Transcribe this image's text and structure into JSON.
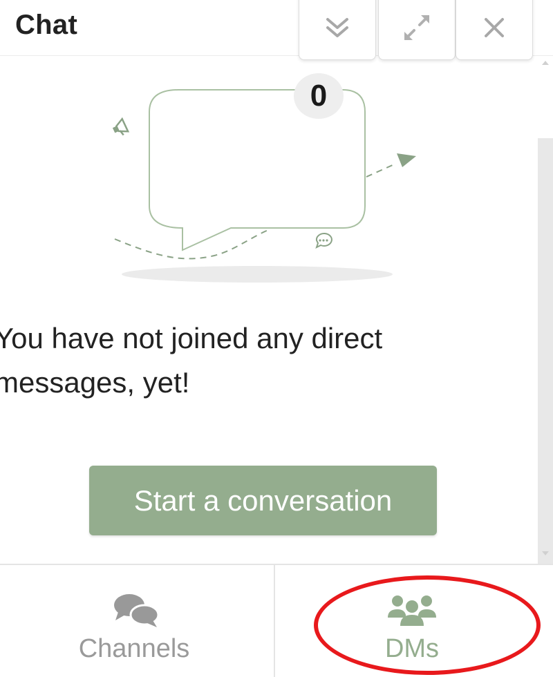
{
  "header": {
    "title": "Chat",
    "buttons": [
      {
        "name": "collapse",
        "icon": "double-chevron-down-icon"
      },
      {
        "name": "expand",
        "icon": "expand-arrows-icon"
      },
      {
        "name": "close",
        "icon": "close-icon"
      }
    ]
  },
  "empty_state": {
    "count": "0",
    "message": "You have not joined any direct messages, yet!",
    "action_label": "Start a conversation"
  },
  "nav": {
    "tabs": [
      {
        "label": "Channels",
        "icon": "channels-chat-bubbles-icon",
        "active": false
      },
      {
        "label": "DMs",
        "icon": "dms-people-group-icon",
        "active": true
      }
    ]
  },
  "colors": {
    "accent": "#94ad8e",
    "annotation_ring": "#e8191c",
    "inactive_text": "#9a9a9a"
  }
}
